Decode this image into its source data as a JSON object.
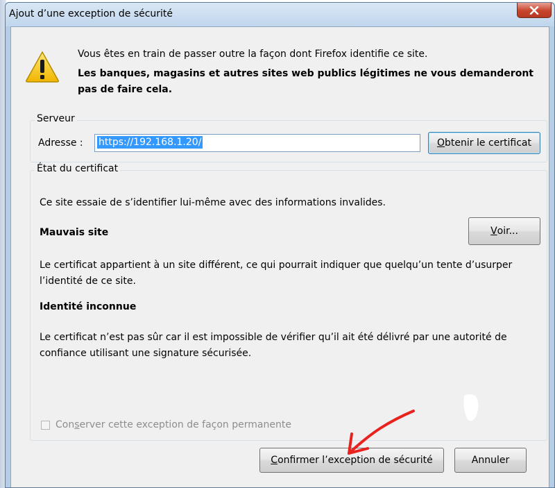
{
  "window": {
    "title": "Ajout d’une exception de sécurité",
    "close_glyph": "x"
  },
  "message": {
    "line1": "Vous êtes en train de passer outre la façon dont Firefox identifie ce site.",
    "line2": "Les banques, magasins et autres sites web publics légitimes ne vous demanderont pas de faire cela."
  },
  "server": {
    "legend": "Serveur",
    "address_label": "Adresse :",
    "address_value": "https://192.168.1.20/",
    "get_cert_button": {
      "ul": "O",
      "rest": "btenir le certificat"
    }
  },
  "cert_status": {
    "legend": "État du certificat",
    "intro": "Ce site essaie de s’identifier lui-même avec des informations invalides.",
    "view_button": {
      "ul": "V",
      "rest": "oir..."
    },
    "wrong_site_title": "Mauvais site",
    "wrong_site_text": "Le certificat appartient à un site différent, ce qui pourrait indiquer que quelqu’un tente d’usurper l’identité de ce site.",
    "unknown_identity_title": "Identité inconnue",
    "unknown_identity_text": "Le certificat n’est pas sûr car il est impossible de vérifier qu’il ait été délivré par une autorité de confiance utilisant une signature sécurisée.",
    "permanent_checkbox": {
      "before": "Con",
      "ul": "s",
      "after": "erver cette exception de façon permanente",
      "checked": false,
      "enabled": false
    }
  },
  "buttons": {
    "confirm": {
      "ul": "C",
      "rest": "onfirmer l’exception de sécurité"
    },
    "cancel": "Annuler"
  },
  "icons": {
    "warning": "warning-triangle-icon",
    "close": "close-icon"
  },
  "colors": {
    "selection": "#3399ff",
    "close_button": "#c7442d",
    "annotation_arrow": "#e8231f",
    "warning_yellow": "#f4c400"
  }
}
